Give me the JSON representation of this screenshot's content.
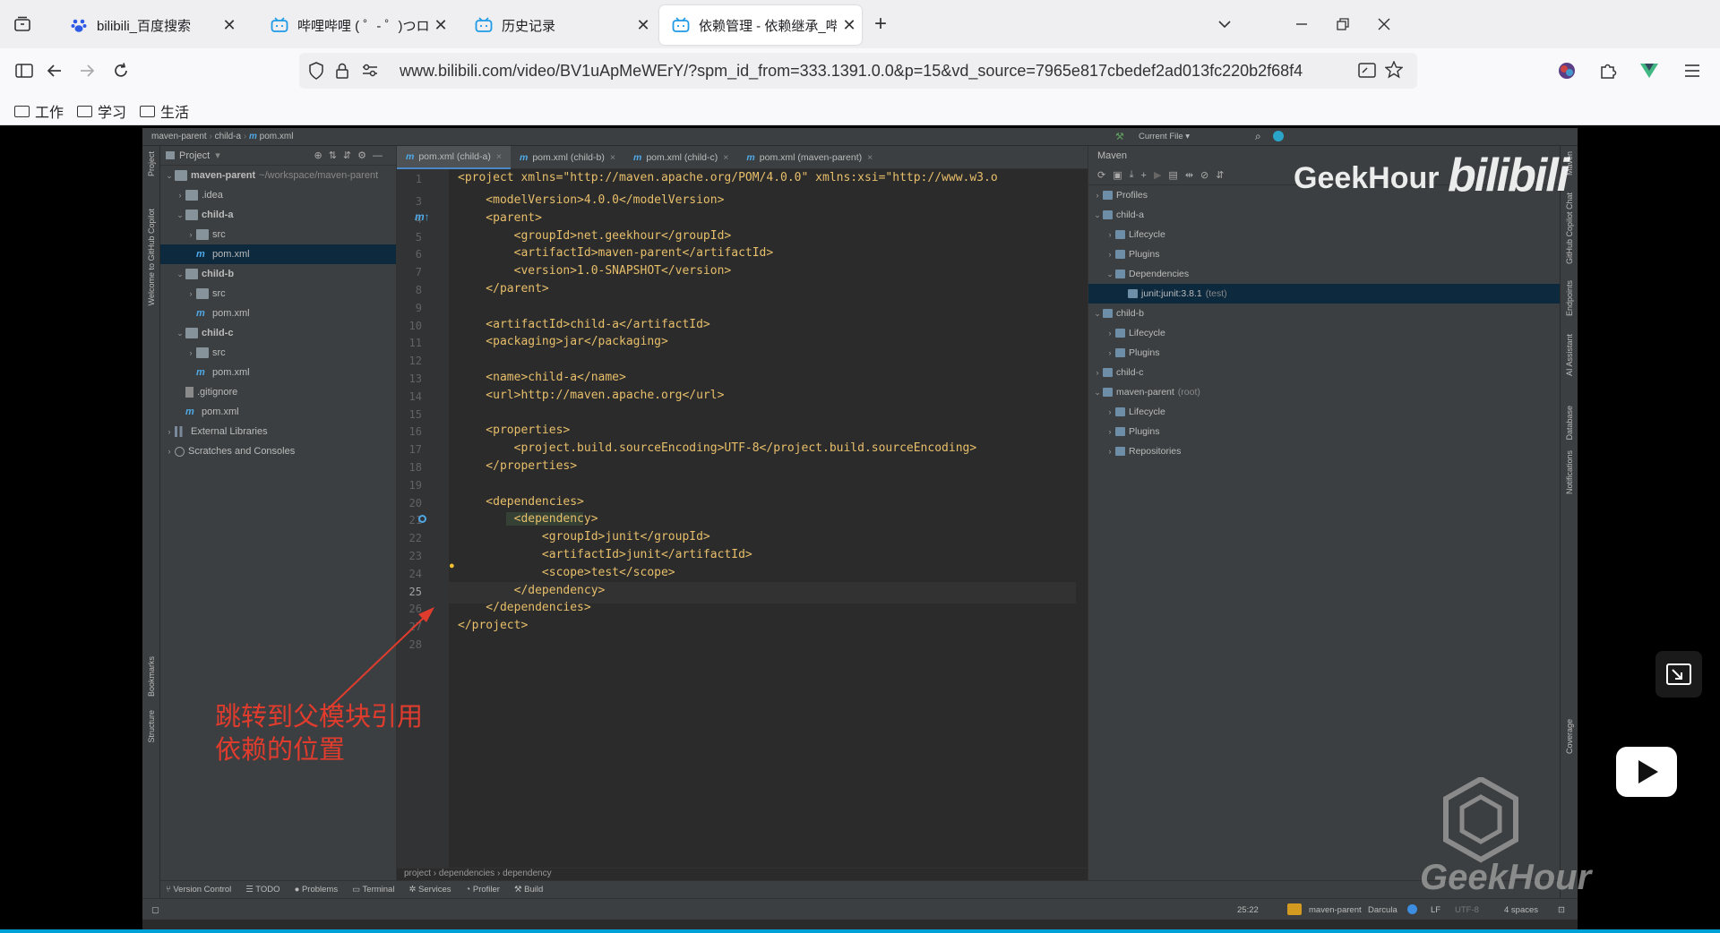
{
  "browser": {
    "tabs": [
      {
        "label": "bilibili_百度搜索",
        "icon": "baidu-paw-icon",
        "active": false
      },
      {
        "label": "哔哩哔哩 ( ゜- ゜)つロ 干杯~-bili",
        "icon": "bilibili-tv-icon",
        "active": false
      },
      {
        "label": "历史记录",
        "icon": "bilibili-tv-icon",
        "active": false
      },
      {
        "label": "依赖管理 - 依赖继承_哔哩哔哩_",
        "icon": "bilibili-tv-icon",
        "active": true
      }
    ],
    "new_tab": "+",
    "url": "www.bilibili.com/video/BV1uApMeWErY/?spm_id_from=333.1391.0.0&p=15&vd_source=7965e817cbedef2ad013fc220b2f68f4",
    "bookmarks": [
      "工作",
      "学习",
      "生活"
    ]
  },
  "ide": {
    "breadcrumb": [
      "maven-parent",
      "child-a",
      "pom.xml"
    ],
    "left_strip": [
      "Project",
      "Welcome to GitHub Copilot",
      "Bookmarks",
      "Structure"
    ],
    "right_strip": [
      "Maven",
      "GitHub Copilot Chat",
      "Endpoints",
      "AI Assistant",
      "Database",
      "Notifications",
      "Coverage"
    ],
    "toolbar": {
      "run_config": "Current File"
    },
    "project_panel": {
      "title": "Project",
      "tree": [
        {
          "label": "maven-parent",
          "note": "~/workspace/maven-parent",
          "type": "module",
          "depth": 0,
          "open": true
        },
        {
          "label": ".idea",
          "type": "dir",
          "depth": 1,
          "open": false
        },
        {
          "label": "child-a",
          "type": "module",
          "depth": 1,
          "open": true
        },
        {
          "label": "src",
          "type": "dir",
          "depth": 2,
          "open": false
        },
        {
          "label": "pom.xml",
          "type": "maven",
          "depth": 2,
          "selected": true
        },
        {
          "label": "child-b",
          "type": "module",
          "depth": 1,
          "open": true
        },
        {
          "label": "src",
          "type": "dir",
          "depth": 2,
          "open": false
        },
        {
          "label": "pom.xml",
          "type": "maven",
          "depth": 2
        },
        {
          "label": "child-c",
          "type": "module",
          "depth": 1,
          "open": true
        },
        {
          "label": "src",
          "type": "dir",
          "depth": 2,
          "open": false
        },
        {
          "label": "pom.xml",
          "type": "maven",
          "depth": 2
        },
        {
          "label": ".gitignore",
          "type": "file",
          "depth": 1
        },
        {
          "label": "pom.xml",
          "type": "maven",
          "depth": 1
        },
        {
          "label": "External Libraries",
          "type": "lib",
          "depth": 0,
          "open": false
        },
        {
          "label": "Scratches and Consoles",
          "type": "scratch",
          "depth": 0,
          "open": false
        }
      ]
    },
    "editor_tabs": [
      {
        "label": "pom.xml (child-a)",
        "active": true
      },
      {
        "label": "pom.xml (child-b)",
        "active": false
      },
      {
        "label": "pom.xml (child-c)",
        "active": false
      },
      {
        "label": "pom.xml (maven-parent)",
        "active": false
      }
    ],
    "code_lines": [
      {
        "n": "1",
        "text": "<project xmlns=\"http://maven.apache.org/POM/4.0.0\" xmlns:xsi=\"http://www.w3.o"
      },
      {
        "n": "3",
        "text": "    <modelVersion>4.0.0</modelVersion>"
      },
      {
        "n": "4",
        "text": "    <parent>"
      },
      {
        "n": "5",
        "text": "        <groupId>net.geekhour</groupId>"
      },
      {
        "n": "6",
        "text": "        <artifactId>maven-parent</artifactId>"
      },
      {
        "n": "7",
        "text": "        <version>1.0-SNAPSHOT</version>"
      },
      {
        "n": "8",
        "text": "    </parent>"
      },
      {
        "n": "9",
        "text": ""
      },
      {
        "n": "10",
        "text": "    <artifactId>child-a</artifactId>"
      },
      {
        "n": "11",
        "text": "    <packaging>jar</packaging>"
      },
      {
        "n": "12",
        "text": ""
      },
      {
        "n": "13",
        "text": "    <name>child-a</name>"
      },
      {
        "n": "14",
        "text": "    <url>http://maven.apache.org</url>"
      },
      {
        "n": "15",
        "text": ""
      },
      {
        "n": "16",
        "text": "    <properties>"
      },
      {
        "n": "17",
        "text": "        <project.build.sourceEncoding>UTF-8</project.build.sourceEncoding>"
      },
      {
        "n": "18",
        "text": "    </properties>"
      },
      {
        "n": "19",
        "text": ""
      },
      {
        "n": "20",
        "text": "    <dependencies>"
      },
      {
        "n": "21",
        "text": "        <dependency>"
      },
      {
        "n": "22",
        "text": "            <groupId>junit</groupId>"
      },
      {
        "n": "23",
        "text": "            <artifactId>junit</artifactId>"
      },
      {
        "n": "24",
        "text": "            <scope>test</scope>"
      },
      {
        "n": "25",
        "text": "        </dependency>"
      },
      {
        "n": "26",
        "text": "    </dependencies>"
      },
      {
        "n": "27",
        "text": "</project>"
      },
      {
        "n": "28",
        "text": ""
      }
    ],
    "editor_breadcrumb": [
      "project",
      "dependencies",
      "dependency"
    ],
    "maven_panel": {
      "title": "Maven",
      "tree": [
        {
          "label": "Profiles",
          "depth": 0,
          "open": false
        },
        {
          "label": "child-a",
          "depth": 0,
          "open": true
        },
        {
          "label": "Lifecycle",
          "depth": 1,
          "open": false
        },
        {
          "label": "Plugins",
          "depth": 1,
          "open": false
        },
        {
          "label": "Dependencies",
          "depth": 1,
          "open": true
        },
        {
          "label": "junit:junit:3.8.1",
          "note": "(test)",
          "depth": 2,
          "selected": true
        },
        {
          "label": "child-b",
          "depth": 0,
          "open": true
        },
        {
          "label": "Lifecycle",
          "depth": 1,
          "open": false
        },
        {
          "label": "Plugins",
          "depth": 1,
          "open": false
        },
        {
          "label": "child-c",
          "depth": 0,
          "open": false
        },
        {
          "label": "maven-parent",
          "note": "(root)",
          "depth": 0,
          "open": true
        },
        {
          "label": "Lifecycle",
          "depth": 1,
          "open": false
        },
        {
          "label": "Plugins",
          "depth": 1,
          "open": false
        },
        {
          "label": "Repositories",
          "depth": 1,
          "open": false
        }
      ]
    },
    "bottom_tools": [
      "Version Control",
      "TODO",
      "Problems",
      "Terminal",
      "Services",
      "Profiler",
      "Build"
    ],
    "status": {
      "position": "25:22",
      "project": "maven-parent",
      "theme": "Darcula",
      "line_sep": "LF",
      "encoding": "UTF-8",
      "indent": "4 spaces"
    }
  },
  "annotation": {
    "line1": "跳转到父模块引用",
    "line2": "依赖的位置"
  },
  "watermark": {
    "geekhour": "GeekHour",
    "bilibili": "bilibili",
    "geekhour_logo": "GeekHour"
  },
  "colors": {
    "ide_bg": "#2b2b2b",
    "tag": "#e8bf6a",
    "annotation": "#e03c2e",
    "selection": "#0d293e"
  }
}
